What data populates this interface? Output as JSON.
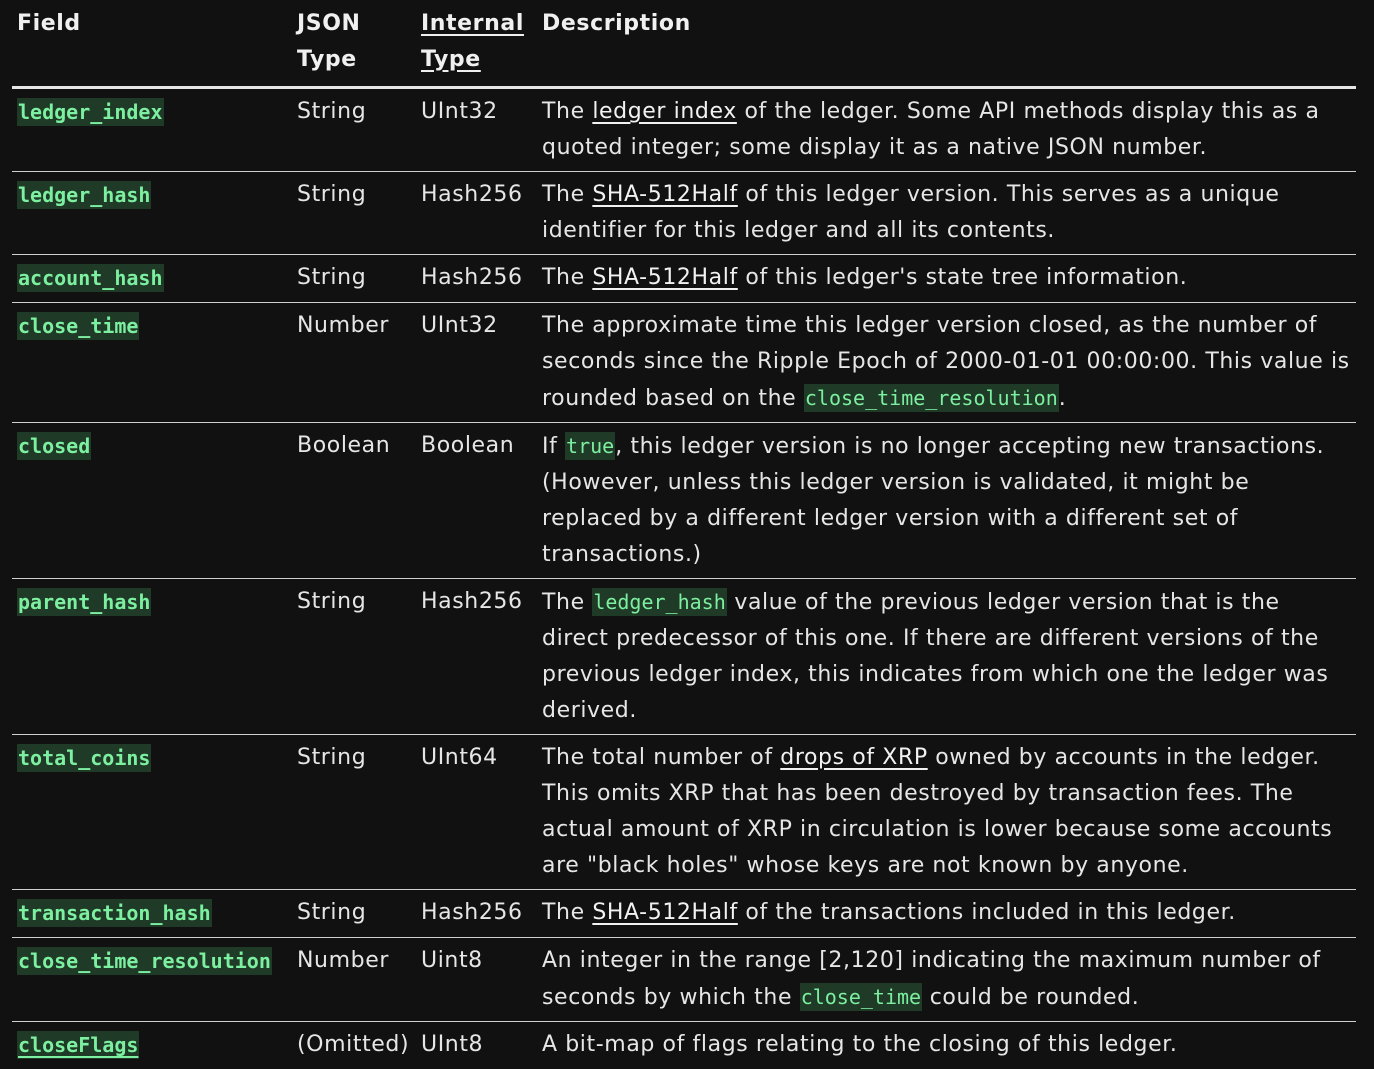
{
  "headers": {
    "field": "Field",
    "json_type": "JSON Type",
    "internal_type": "Internal Type",
    "description": "Description"
  },
  "rows": [
    {
      "field": "ledger_index",
      "json_type": "String",
      "internal_type": "UInt32",
      "desc": [
        {
          "t": "text",
          "v": "The "
        },
        {
          "t": "link",
          "v": "ledger index"
        },
        {
          "t": "text",
          "v": " of the ledger. Some API methods display this as a quoted integer; some display it as a native JSON number."
        }
      ]
    },
    {
      "field": "ledger_hash",
      "json_type": "String",
      "internal_type": "Hash256",
      "desc": [
        {
          "t": "text",
          "v": "The "
        },
        {
          "t": "link",
          "v": "SHA-512Half"
        },
        {
          "t": "text",
          "v": " of this ledger version. This serves as a unique identifier for this ledger and all its contents."
        }
      ]
    },
    {
      "field": "account_hash",
      "json_type": "String",
      "internal_type": "Hash256",
      "desc": [
        {
          "t": "text",
          "v": "The "
        },
        {
          "t": "link",
          "v": "SHA-512Half"
        },
        {
          "t": "text",
          "v": " of this ledger's state tree information."
        }
      ]
    },
    {
      "field": "close_time",
      "json_type": "Number",
      "internal_type": "UInt32",
      "desc": [
        {
          "t": "text",
          "v": "The approximate time this ledger version closed, as the number of seconds since the Ripple Epoch of 2000-01-01 00:00:00. This value is rounded based on the "
        },
        {
          "t": "code",
          "v": "close_time_resolution"
        },
        {
          "t": "text",
          "v": "."
        }
      ]
    },
    {
      "field": "closed",
      "json_type": "Boolean",
      "internal_type": "Boolean",
      "desc": [
        {
          "t": "text",
          "v": "If "
        },
        {
          "t": "code",
          "v": "true"
        },
        {
          "t": "text",
          "v": ", this ledger version is no longer accepting new transactions. (However, unless this ledger version is validated, it might be replaced by a different ledger version with a different set of transactions.)"
        }
      ]
    },
    {
      "field": "parent_hash",
      "json_type": "String",
      "internal_type": "Hash256",
      "desc": [
        {
          "t": "text",
          "v": "The "
        },
        {
          "t": "code",
          "v": "ledger_hash"
        },
        {
          "t": "text",
          "v": " value of the previous ledger version that is the direct predecessor of this one. If there are different versions of the previous ledger index, this indicates from which one the ledger was derived."
        }
      ]
    },
    {
      "field": "total_coins",
      "json_type": "String",
      "internal_type": "UInt64",
      "desc": [
        {
          "t": "text",
          "v": "The total number of "
        },
        {
          "t": "link",
          "v": "drops of XRP"
        },
        {
          "t": "text",
          "v": " owned by accounts in the ledger. This omits XRP that has been destroyed by transaction fees. The actual amount of XRP in circulation is lower because some accounts are \"black holes\" whose keys are not known by anyone."
        }
      ]
    },
    {
      "field": "transaction_hash",
      "json_type": "String",
      "internal_type": "Hash256",
      "desc": [
        {
          "t": "text",
          "v": "The "
        },
        {
          "t": "link",
          "v": "SHA-512Half"
        },
        {
          "t": "text",
          "v": " of the transactions included in this ledger."
        }
      ]
    },
    {
      "field": "close_time_resolution",
      "json_type": "Number",
      "internal_type": "Uint8",
      "desc": [
        {
          "t": "text",
          "v": "An integer in the range [2,120] indicating the maximum number of seconds by which the "
        },
        {
          "t": "code",
          "v": "close_time"
        },
        {
          "t": "text",
          "v": " could be rounded."
        }
      ]
    },
    {
      "field": "closeFlags",
      "field_link": true,
      "json_type": "(Omitted)",
      "internal_type": "UInt8",
      "desc": [
        {
          "t": "text",
          "v": "A bit-map of flags relating to the closing of this ledger."
        }
      ]
    }
  ]
}
